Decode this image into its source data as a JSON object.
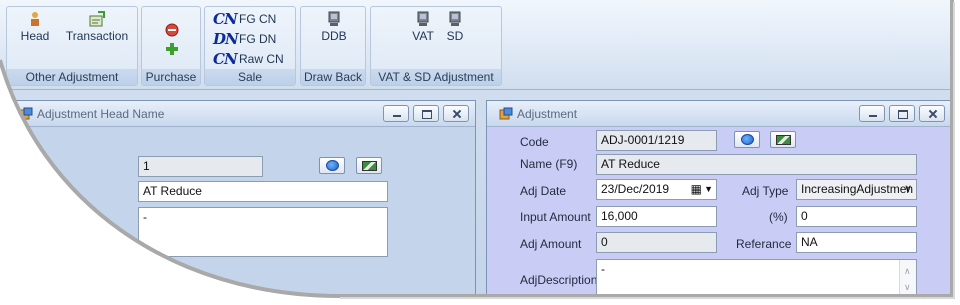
{
  "ribbon": {
    "groups": [
      {
        "label": "Other Adjustment",
        "buttons": [
          "Head",
          "Transaction"
        ]
      },
      {
        "label": "Purchase"
      },
      {
        "label": "Sale",
        "items": [
          {
            "icon_text": "CN",
            "label": "FG CN"
          },
          {
            "icon_text": "DN",
            "label": "FG DN"
          },
          {
            "icon_text": "CN",
            "label": "Raw CN"
          }
        ]
      },
      {
        "label": "Draw Back",
        "buttons": [
          "DDB"
        ]
      },
      {
        "label": "VAT & SD Adjustment",
        "buttons": [
          "VAT",
          "SD"
        ]
      }
    ]
  },
  "head_window": {
    "title": "Adjustment Head Name",
    "id_value": "1",
    "name_value": "AT Reduce",
    "desc_value": "-"
  },
  "adj_window": {
    "title": "Adjustment",
    "code_label": "Code",
    "code_value": "ADJ-0001/1219",
    "name_label": "Name (F9)",
    "name_value": "AT Reduce",
    "date_label": "Adj Date",
    "date_value": "23/Dec/2019",
    "type_label": "Adj Type",
    "type_value": "IncreasingAdjustmen",
    "input_label": "Input Amount",
    "input_value": "16,000",
    "pct_label": "(%)",
    "pct_value": "0",
    "amount_label": "Adj Amount",
    "amount_value": "0",
    "ref_label": "Referance",
    "ref_value": "NA",
    "desc_label": "AdjDescription",
    "desc_value": "-"
  },
  "colors": {
    "frame_accent": "#a9a9a9",
    "ribbon_bg": "#dbe6f4",
    "adj_body": "#c9cdf6"
  }
}
